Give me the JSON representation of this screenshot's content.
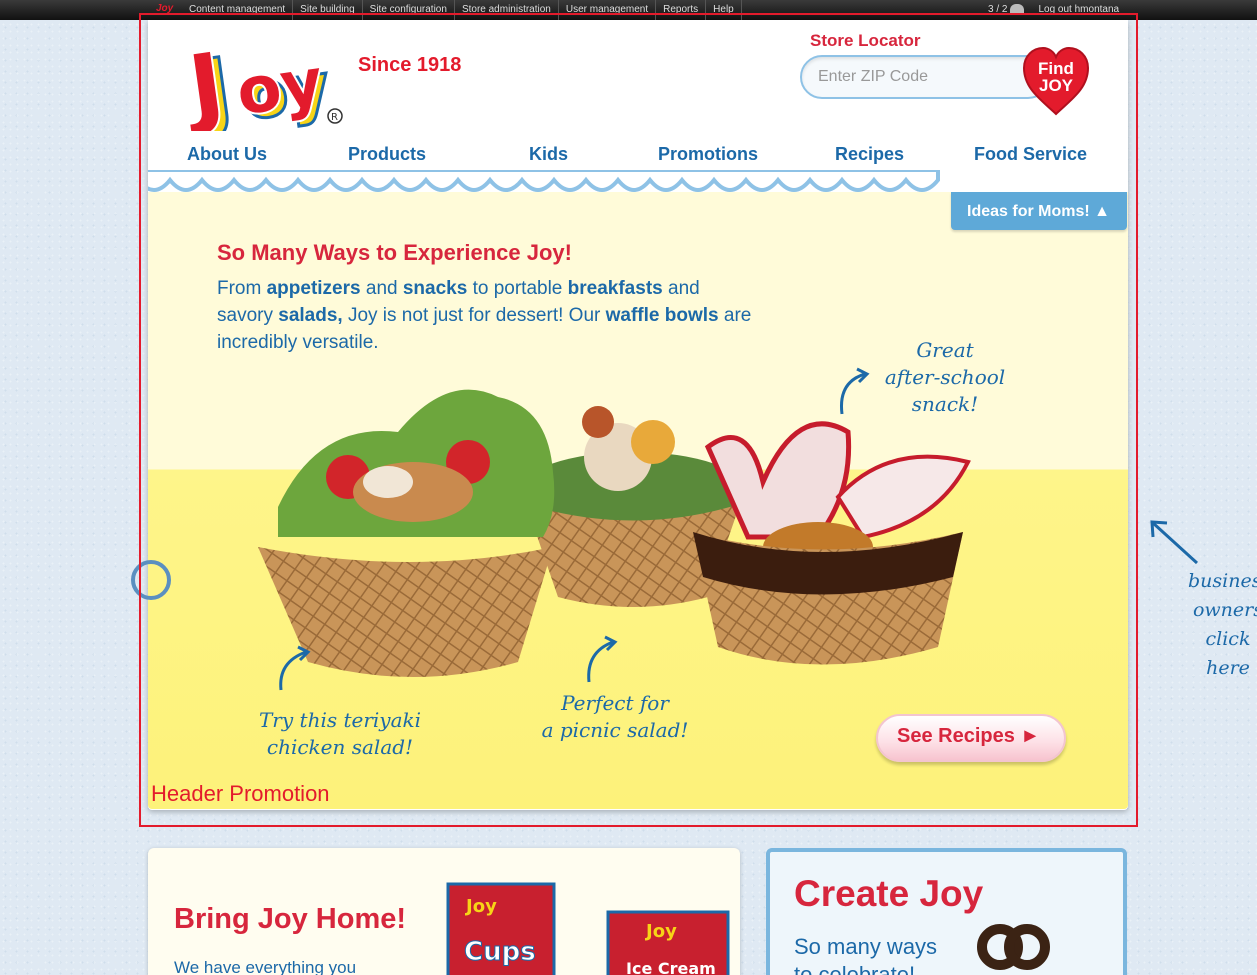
{
  "admin_bar": {
    "items": [
      "Content management",
      "Site building",
      "Site configuration",
      "Store administration",
      "User management",
      "Reports",
      "Help"
    ],
    "user_count": "3 / 2",
    "logout": "Log out hmontana"
  },
  "brand": {
    "logo_text": "Joy",
    "since": "Since 1918"
  },
  "store_locator": {
    "label": "Store Locator",
    "placeholder": "Enter ZIP Code",
    "find_button": "Find JOY"
  },
  "nav": {
    "items": [
      "About Us",
      "Products",
      "Kids",
      "Promotions",
      "Recipes",
      "Food Service"
    ]
  },
  "ideas_tab": "Ideas for Moms! ▲",
  "hero": {
    "title": "So Many Ways to Experience Joy!",
    "text_parts": [
      "From ",
      "appetizers",
      " and ",
      "snacks",
      " to portable ",
      "breakfasts",
      " and savory ",
      "salads,",
      " Joy is not just for dessert! Our ",
      "waffle bowls",
      " are incredibly versatile."
    ],
    "note_snack": [
      "Great",
      "after-school",
      "snack!"
    ],
    "note_teriyaki": [
      "Try this teriyaki",
      "chicken salad!"
    ],
    "note_picnic": [
      "Perfect for",
      "a picnic salad!"
    ],
    "see_recipes": "See Recipes ►"
  },
  "region_label": "Header Promotion",
  "side_note": [
    "business",
    "owners",
    "click",
    "here"
  ],
  "bring_home": {
    "title": "Bring Joy Home!",
    "text": "We have everything you"
  },
  "create_joy": {
    "title": "Create Joy",
    "text_lines": [
      "So many ways",
      "to celebrate!"
    ]
  },
  "colors": {
    "brand_red": "#d7263d",
    "brand_blue": "#1c69a8",
    "tab_blue": "#5ea9d8",
    "hero_yellow": "#fef58a"
  }
}
